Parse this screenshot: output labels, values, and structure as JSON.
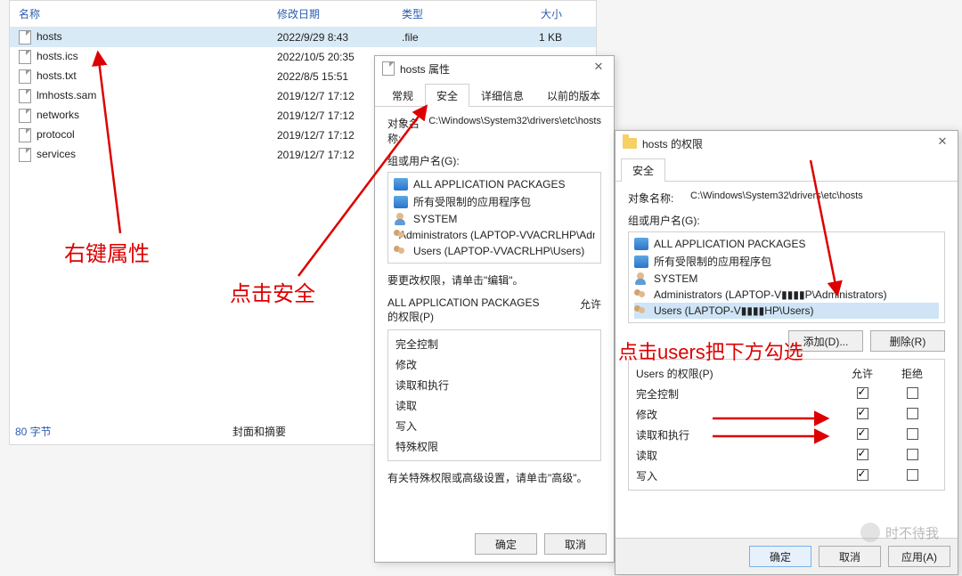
{
  "explorer": {
    "columns": {
      "name": "名称",
      "date": "修改日期",
      "type": "类型",
      "size": "大小"
    },
    "files": [
      {
        "name": "hosts",
        "date": "2022/9/29 8:43",
        "type": ".file",
        "size": "1 KB",
        "selected": true
      },
      {
        "name": "hosts.ics",
        "date": "2022/10/5 20:35",
        "type": "",
        "size": "",
        "selected": false
      },
      {
        "name": "hosts.txt",
        "date": "2022/8/5 15:51",
        "type": "",
        "size": "",
        "selected": false
      },
      {
        "name": "lmhosts.sam",
        "date": "2019/12/7 17:12",
        "type": "",
        "size": "",
        "selected": false
      },
      {
        "name": "networks",
        "date": "2019/12/7 17:12",
        "type": "",
        "size": "",
        "selected": false
      },
      {
        "name": "protocol",
        "date": "2019/12/7 17:12",
        "type": "",
        "size": "",
        "selected": false
      },
      {
        "name": "services",
        "date": "2019/12/7 17:12",
        "type": "",
        "size": "",
        "selected": false
      }
    ],
    "status": "80 字节",
    "addenda": "封面和摘要"
  },
  "props_dialog": {
    "title": "hosts 属性",
    "tabs": {
      "general": "常规",
      "security": "安全",
      "details": "详细信息",
      "previous": "以前的版本"
    },
    "object_name_label": "对象名称:",
    "object_name_value": "C:\\Windows\\System32\\drivers\\etc\\hosts",
    "groups_label": "组或用户名(G):",
    "groups": [
      {
        "icon": "pkg",
        "text": "ALL APPLICATION PACKAGES"
      },
      {
        "icon": "pkg",
        "text": "所有受限制的应用程序包"
      },
      {
        "icon": "user",
        "text": "SYSTEM"
      },
      {
        "icon": "users",
        "text": "Administrators (LAPTOP-VVACRLHP\\Admi…"
      },
      {
        "icon": "users",
        "text": "Users (LAPTOP-VVACRLHP\\Users)"
      }
    ],
    "edit_hint": "要更改权限，请单击\"编辑\"。",
    "perm_header_left": "ALL APPLICATION PACKAGES\n的权限(P)",
    "perm_header_right": "允许",
    "perm_items": [
      "完全控制",
      "修改",
      "读取和执行",
      "读取",
      "写入",
      "特殊权限"
    ],
    "advanced_hint": "有关特殊权限或高级设置，请单击\"高级\"。",
    "buttons": {
      "ok": "确定",
      "cancel": "取消"
    }
  },
  "perms_dialog": {
    "title": "hosts 的权限",
    "tab": "安全",
    "object_name_label": "对象名称:",
    "object_name_value": "C:\\Windows\\System32\\drivers\\etc\\hosts",
    "groups_label": "组或用户名(G):",
    "groups": [
      {
        "icon": "pkg",
        "text": "ALL APPLICATION PACKAGES",
        "selected": false
      },
      {
        "icon": "pkg",
        "text": "所有受限制的应用程序包",
        "selected": false
      },
      {
        "icon": "user",
        "text": "SYSTEM",
        "selected": false
      },
      {
        "icon": "users",
        "text": "Administrators (LAPTOP-V▮▮▮▮P\\Administrators)",
        "selected": false
      },
      {
        "icon": "users",
        "text": "Users (LAPTOP-V▮▮▮▮HP\\Users)",
        "selected": true
      }
    ],
    "add_btn": "添加(D)...",
    "remove_btn": "删除(R)",
    "perm_header_left": "Users 的权限(P)",
    "perm_allow": "允许",
    "perm_deny": "拒绝",
    "perm_rows": [
      {
        "label": "完全控制",
        "allow": true,
        "deny": false
      },
      {
        "label": "修改",
        "allow": true,
        "deny": false
      },
      {
        "label": "读取和执行",
        "allow": true,
        "deny": false
      },
      {
        "label": "读取",
        "allow": true,
        "deny": false
      },
      {
        "label": "写入",
        "allow": true,
        "deny": false
      }
    ],
    "buttons": {
      "ok": "确定",
      "cancel": "取消",
      "apply": "应用(A)"
    }
  },
  "annotations": {
    "a1": "右键属性",
    "a2": "点击安全",
    "a3": "点击users把下方勾选"
  },
  "watermark": "时不待我"
}
